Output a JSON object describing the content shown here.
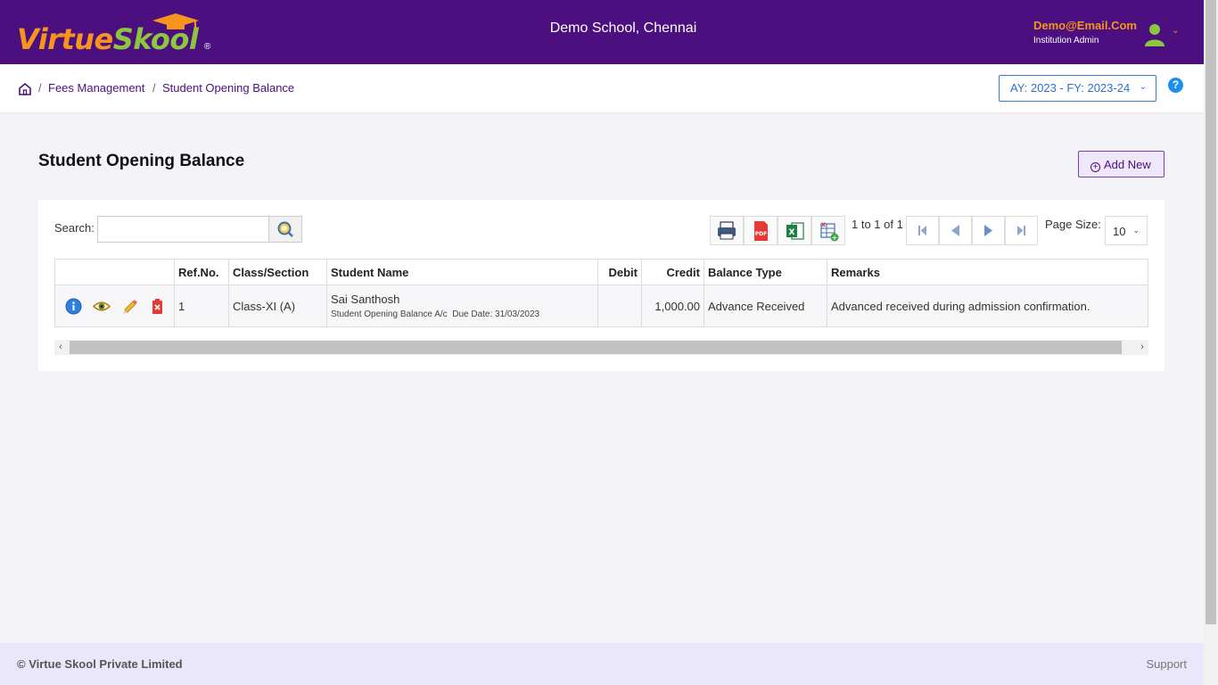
{
  "header": {
    "logo": {
      "part1": "Virtue",
      "part2": "Skool",
      "reg": "®"
    },
    "school_name": "Demo School, Chennai",
    "user_email": "Demo@Email.Com",
    "user_role": "Institution Admin"
  },
  "breadcrumb": {
    "items": [
      "Fees Management",
      "Student Opening Balance"
    ],
    "separator": "/"
  },
  "year_selector": {
    "value": "AY: 2023 - FY: 2023-24"
  },
  "page": {
    "title": "Student Opening Balance",
    "add_new_label": "Add New"
  },
  "grid": {
    "search_label": "Search:",
    "search_value": "",
    "pager_info": "1 to 1 of 1",
    "page_size_label": "Page Size:",
    "page_size": "10",
    "columns": [
      "",
      "Ref.No.",
      "Class/Section",
      "Student Name",
      "Debit",
      "Credit",
      "Balance Type",
      "Remarks"
    ],
    "rows": [
      {
        "ref_no": "1",
        "class_section": "Class-XI (A)",
        "student_name": "Sai Santhosh",
        "account": "Student Opening Balance A/c",
        "due_date": "Due Date: 31/03/2023",
        "debit": "",
        "credit": "1,000.00",
        "balance_type": "Advance Received",
        "remarks": "Advanced received during admission confirmation."
      }
    ]
  },
  "footer": {
    "copyright": "© Virtue Skool Private Limited",
    "support": "Support"
  },
  "colors": {
    "header_bg": "#4b0f7f",
    "accent_orange": "#f7941d",
    "accent_green": "#8dc63f",
    "link_blue": "#2e6fca"
  }
}
